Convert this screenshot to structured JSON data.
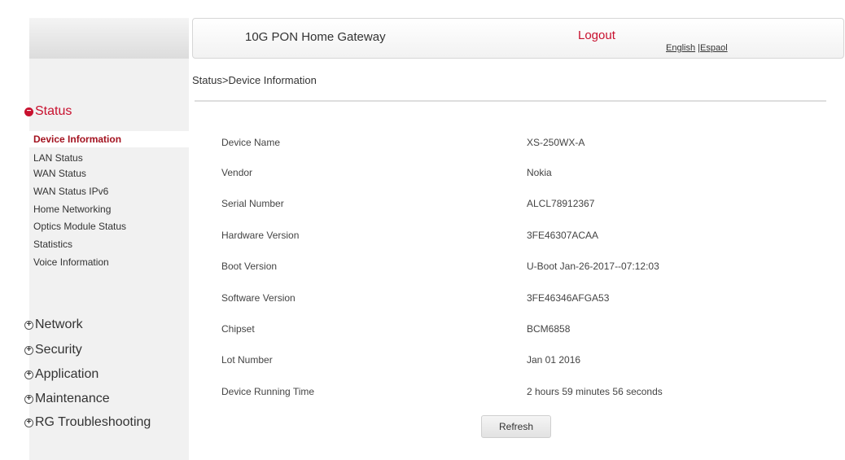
{
  "header": {
    "title": "10G PON Home Gateway",
    "logout_label": "Logout",
    "lang_english": "English",
    "lang_separator": " |",
    "lang_espanol": "Espaol"
  },
  "breadcrumb": "Status>Device Information",
  "sidebar": {
    "status_label": "Status",
    "status_items": [
      {
        "label": "Device Information",
        "active": true
      },
      {
        "label": "LAN Status"
      },
      {
        "label": "WAN Status"
      },
      {
        "label": "WAN Status IPv6"
      },
      {
        "label": "Home Networking"
      },
      {
        "label": "Optics Module Status"
      },
      {
        "label": "Statistics"
      },
      {
        "label": "Voice Information"
      }
    ],
    "sections": [
      {
        "label": "Network"
      },
      {
        "label": "Security"
      },
      {
        "label": "Application"
      },
      {
        "label": "Maintenance"
      },
      {
        "label": "RG Troubleshooting"
      }
    ]
  },
  "device_info": [
    {
      "label": "Device Name",
      "value": "XS-250WX-A"
    },
    {
      "label": "Vendor",
      "value": "Nokia"
    },
    {
      "label": "Serial Number",
      "value": "ALCL78912367"
    },
    {
      "label": "Hardware Version",
      "value": "3FE46307ACAA"
    },
    {
      "label": "Boot Version",
      "value": "U-Boot Jan-26-2017--07:12:03"
    },
    {
      "label": "Software Version",
      "value": "3FE46346AFGA53"
    },
    {
      "label": "Chipset",
      "value": "BCM6858"
    },
    {
      "label": "Lot Number",
      "value": "Jan 01 2016"
    },
    {
      "label": "Device Running Time",
      "value": "2 hours 59 minutes 56 seconds"
    }
  ],
  "refresh_label": "Refresh",
  "colors": {
    "accent": "#c8102e",
    "active_item": "#a3121f"
  }
}
